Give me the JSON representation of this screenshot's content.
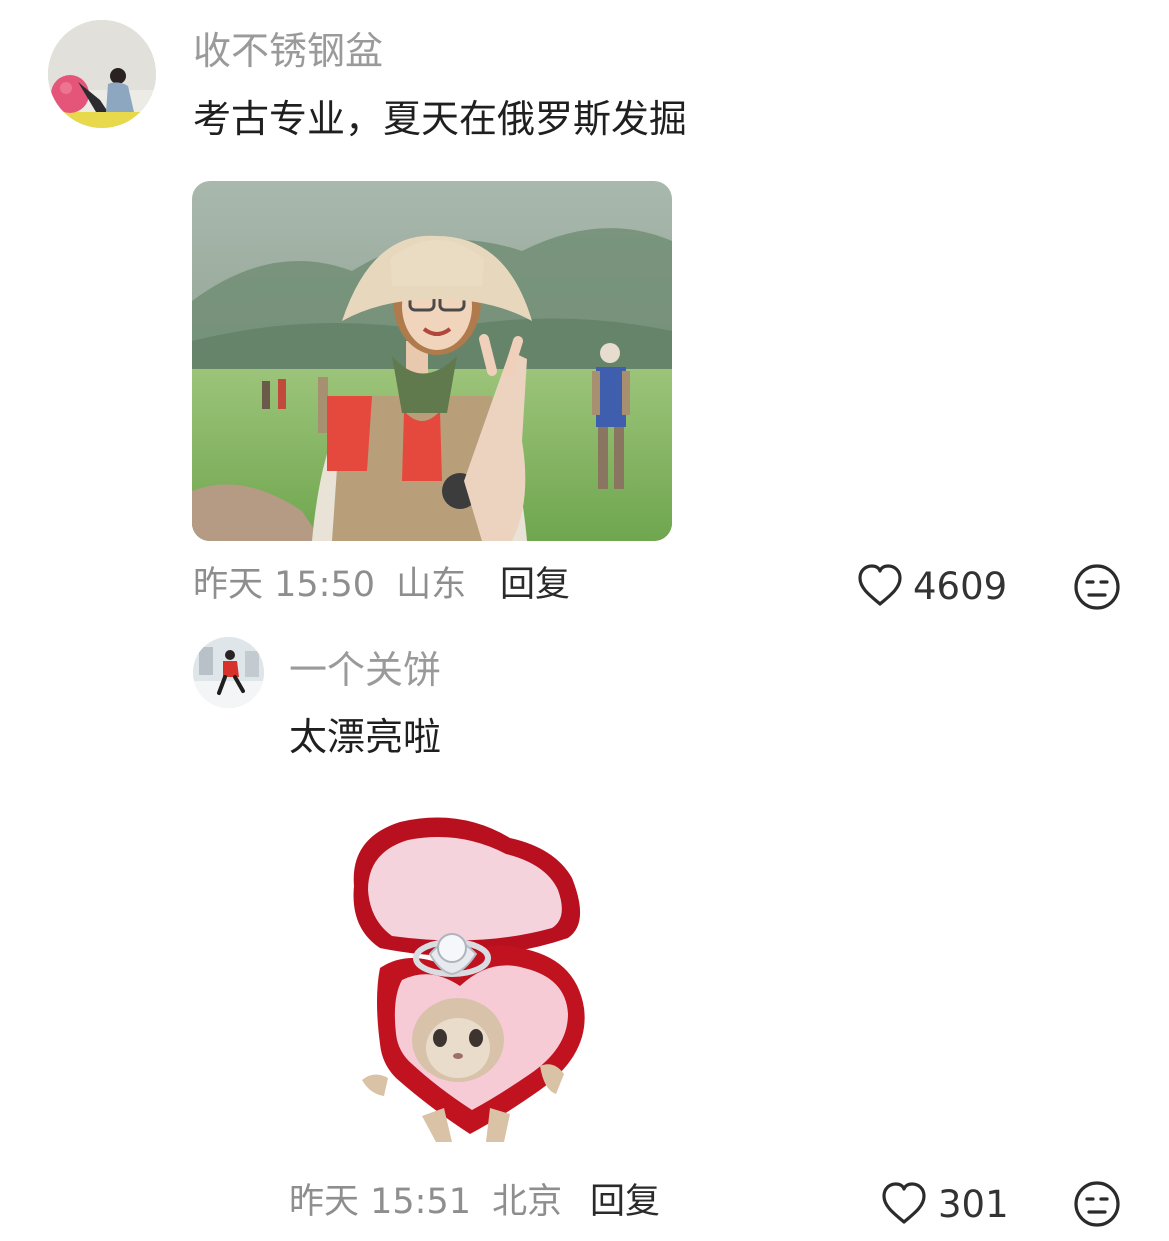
{
  "comments": [
    {
      "username": "收不锈钢盆",
      "text": "考古专业，夏天在俄罗斯发掘",
      "time": "昨天 15:50",
      "location": "山东",
      "reply_label": "回复",
      "likes": "4609",
      "avatar": "avatar-photo-pink-ball",
      "attachment": "photo-woman-field-hat-peace-sign",
      "dislike_icon": "meh-face-icon"
    },
    {
      "username": "一个关饼",
      "text": "太漂亮啦",
      "time": "昨天 15:51",
      "location": "北京",
      "reply_label": "回复",
      "likes": "301",
      "avatar": "avatar-photo-snow-walk",
      "attachment": "sticker-cat-heart-ring-box",
      "dislike_icon": "meh-face-icon"
    }
  ],
  "colors": {
    "username": "#9a9a9a",
    "meta": "#8e8e8e",
    "text": "#1f1f1f",
    "icon": "#2b2b2b",
    "heart_box": "#c8102e"
  }
}
